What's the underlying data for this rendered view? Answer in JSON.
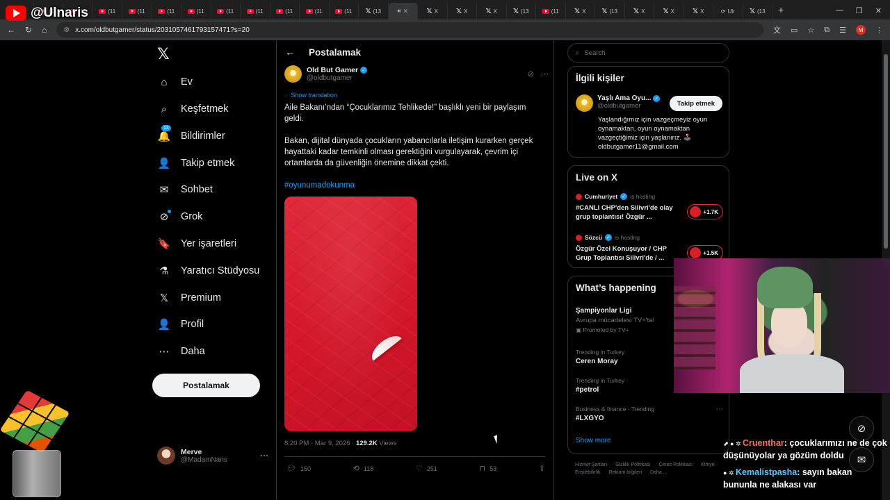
{
  "overlay": {
    "yt_handle": "@Ulnaris",
    "chat": [
      {
        "user": "Cruenthar",
        "text": ": çocuklarımızı ne de çok düşünüyolar ya gözüm doldu"
      },
      {
        "user": "Kemalistpasha",
        "text": ": sayın bakan bununla ne alakası var"
      }
    ]
  },
  "browser": {
    "tabs": [
      {
        "icon": "yt",
        "label": "(11"
      },
      {
        "icon": "yt",
        "label": "(11"
      },
      {
        "icon": "yt",
        "label": "(11"
      },
      {
        "icon": "yt",
        "label": "(11"
      },
      {
        "icon": "yt",
        "label": "(11"
      },
      {
        "icon": "yt",
        "label": "(11"
      },
      {
        "icon": "yt",
        "label": "(11"
      },
      {
        "icon": "yt",
        "label": "(11"
      },
      {
        "icon": "yt",
        "label": "(11"
      },
      {
        "icon": "yt",
        "label": "(11"
      },
      {
        "icon": "yt",
        "label": "(11"
      },
      {
        "icon": "yt",
        "label": "(11"
      },
      {
        "icon": "x",
        "label": "(13"
      },
      {
        "icon": "active",
        "label": ""
      },
      {
        "icon": "x",
        "label": "X"
      },
      {
        "icon": "x",
        "label": "X"
      },
      {
        "icon": "x",
        "label": "X"
      },
      {
        "icon": "x",
        "label": "(13"
      },
      {
        "icon": "yt",
        "label": "(11"
      },
      {
        "icon": "x",
        "label": "X"
      },
      {
        "icon": "x",
        "label": "(13"
      },
      {
        "icon": "x",
        "label": "X"
      },
      {
        "icon": "x",
        "label": "X"
      },
      {
        "icon": "x",
        "label": "X"
      },
      {
        "icon": "ul",
        "label": "Ulr"
      },
      {
        "icon": "x",
        "label": "(13"
      }
    ],
    "url": "x.com/oldbutgamer/status/2031057461793157471?s=20",
    "profile_initial": "M"
  },
  "nav": {
    "items": [
      {
        "icon": "home-icon",
        "glyph": "⌂",
        "label": "Ev"
      },
      {
        "icon": "explore-icon",
        "glyph": "⌕",
        "label": "Keşfetmek"
      },
      {
        "icon": "bell-icon",
        "glyph": "🔔",
        "label": "Bildirimler",
        "badge": "13"
      },
      {
        "icon": "follow-icon",
        "glyph": "👤",
        "label": "Takip etmek"
      },
      {
        "icon": "mail-icon",
        "glyph": "✉",
        "label": "Sohbet"
      },
      {
        "icon": "grok-icon",
        "glyph": "⊘",
        "label": "Grok"
      },
      {
        "icon": "bookmark-icon",
        "glyph": "🔖",
        "label": "Yer işaretleri"
      },
      {
        "icon": "flask-icon",
        "glyph": "⚗",
        "label": "Yaratıcı Stüdyosu"
      },
      {
        "icon": "x-icon",
        "glyph": "𝕏",
        "label": "Premium"
      },
      {
        "icon": "profile-icon",
        "glyph": "👤",
        "label": "Profil"
      },
      {
        "icon": "more-icon",
        "glyph": "⋯",
        "label": "Daha"
      }
    ],
    "post_label": "Postalamak",
    "account": {
      "name": "Merve",
      "handle": "@MadamNaris"
    }
  },
  "main": {
    "header": "Postalamak",
    "author": {
      "name": "Old But Gamer",
      "handle": "@oldbutgamer"
    },
    "translate": "Show translation",
    "text_p1": "Aile Bakanı’ndan “Çocuklarımız Tehlikede!” başlıklı yeni bir paylaşım geldi.",
    "text_p2": "Bakan, dijital dünyada çocukların yabancılarla iletişim kurarken gerçek hayattaki kadar temkinli olması gerektiğini vurgulayarak, çevrim içi ortamlarda da güvenliğin önemine dikkat çekti.",
    "hashtag": "#oyunumadokunma",
    "time": "8:20 PM · Mar 9, 2026 · ",
    "views": "129.2K",
    "views_label": " Views",
    "stats": {
      "replies": "150",
      "reposts": "118",
      "likes": "251",
      "bookmarks": "53"
    }
  },
  "sidebar": {
    "search_placeholder": "Search",
    "related": {
      "title": "İlgili kişiler",
      "name": "Yaşlı Ama Oyu...",
      "handle": "@oldbutgamer",
      "follow": "Takip etmek",
      "bio": "Yaşlandığımız için vazgeçmeyiz oyun oynamaktan, oyun oynamaktan vazgeçtiğimiz için yaşlanırız. 🕹️ oldbutgamer11@gmail.com"
    },
    "live": {
      "title": "Live on X",
      "items": [
        {
          "source": "Cumhuriyet",
          "hosting": "is hosting",
          "text": "#CANLI CHP'den Silivri'de olay grup toplantısı! Özgür ...",
          "count": "+1.7K"
        },
        {
          "source": "Sözcü",
          "hosting": "is hosting",
          "text": "Özgür Özel Konuşuyor / CHP Grup Toplantısı Silivri'de / ...",
          "count": "+1.5K"
        }
      ]
    },
    "happening": {
      "title": "What’s happening",
      "promo": {
        "title": "Şampiyonlar Ligi",
        "sub": "Avrupa mücadelesi TV+'ta!",
        "promoted": "Promoted by TV+"
      },
      "trends": [
        {
          "context": "Trending in Turkey",
          "title": "Ceren Moray"
        },
        {
          "context": "Trending in Turkey",
          "title": "#petrol"
        },
        {
          "context": "Business & finance · Trending",
          "title": "#LXGYO"
        }
      ],
      "show_more": "Show more"
    },
    "footer": [
      "Hizmet Şartları",
      "Gizlilik Politikası",
      "Çerez Politikası",
      "Kimye",
      "Erişilebilirlik",
      "Reklam bilgileri",
      "Daha ..."
    ]
  }
}
